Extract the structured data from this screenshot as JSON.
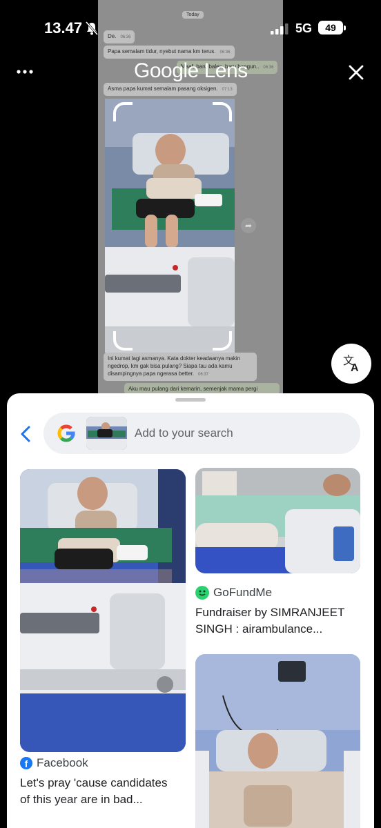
{
  "status_bar": {
    "time": "13.47",
    "network": "5G",
    "battery": "49"
  },
  "lens": {
    "title": "Google Lens"
  },
  "chat": {
    "day": "Today",
    "messages": [
      {
        "text": "De.",
        "time": "06:36"
      },
      {
        "text": "Papa semalam tidur, nyebut nama km terus.",
        "time": "06:36"
      },
      {
        "text": "Maaf, baru bales, baru bangun..",
        "time": "06:36"
      },
      {
        "text": "Asma papa kumat semalam pasang oksigen.",
        "time": "07:13"
      },
      {
        "text": "Ini kumat lagi asmanya. Kata dokter keadaanya makin ngedrop, km gak bisa pulang? Siapa tau ada kamu disampingnya papa ngerasa better.",
        "time": "06:37"
      },
      {
        "text": "Aku mau pulang dari kemarin, semenjak mama pergi"
      }
    ]
  },
  "search": {
    "placeholder": "Add to your search"
  },
  "results": [
    {
      "source": "Facebook",
      "caption_line1": "Let's pray 'cause candidates",
      "caption_line2": "of this year are in bad..."
    },
    {
      "source": "GoFundMe",
      "caption_line1": "Fundraiser by SIMRANJEET",
      "caption_line2": "SINGH : airambulance..."
    }
  ],
  "colors": {
    "accent": "#1a73e8",
    "sheet_bg": "#ffffff",
    "search_bg": "#eef0f3",
    "facebook": "#1877f2",
    "gofundme": "#2bd16f"
  }
}
